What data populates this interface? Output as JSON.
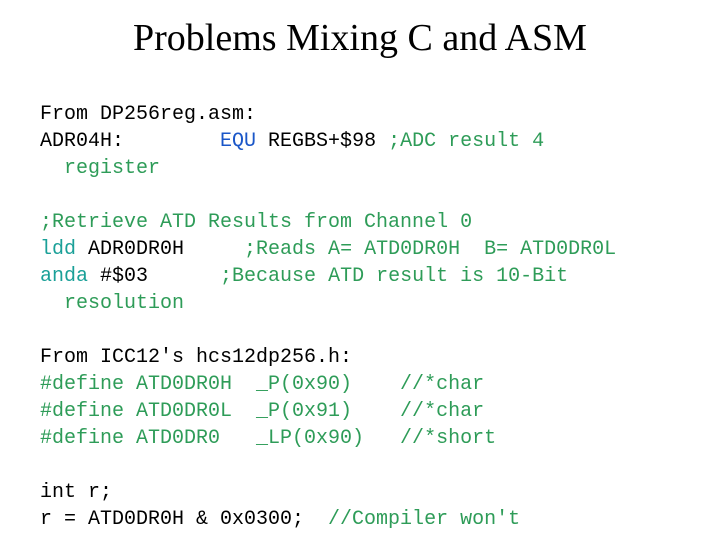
{
  "title": "Problems Mixing C and ASM",
  "line1": "From DP256reg.asm:",
  "line2a": "ADR04H:        ",
  "line2b": "EQU",
  "line2c": " REGBS+$98 ",
  "line2d": ";ADC result 4",
  "line2e": "register",
  "line3": ";Retrieve ATD Results from Channel 0",
  "line4a": "ldd",
  "line4b": " ADR0DR0H     ",
  "line4c": ";Reads A= ATD0DR0H  B= ATD0DR0L",
  "line5a": "anda",
  "line5b": " #$03      ",
  "line5c": ";Because ATD result is 10-Bit",
  "line5d": "resolution",
  "line6": "From ICC12's hcs12dp256.h:",
  "line7": "#define ATD0DR0H  _P(0x90)    //*char",
  "line8": "#define ATD0DR0L  _P(0x91)    //*char",
  "line9": "#define ATD0DR0   _LP(0x90)   //*short",
  "line10": "int r;",
  "line11a": "r = ATD0DR0H & 0x0300;  ",
  "line11b": "//Compiler won't"
}
